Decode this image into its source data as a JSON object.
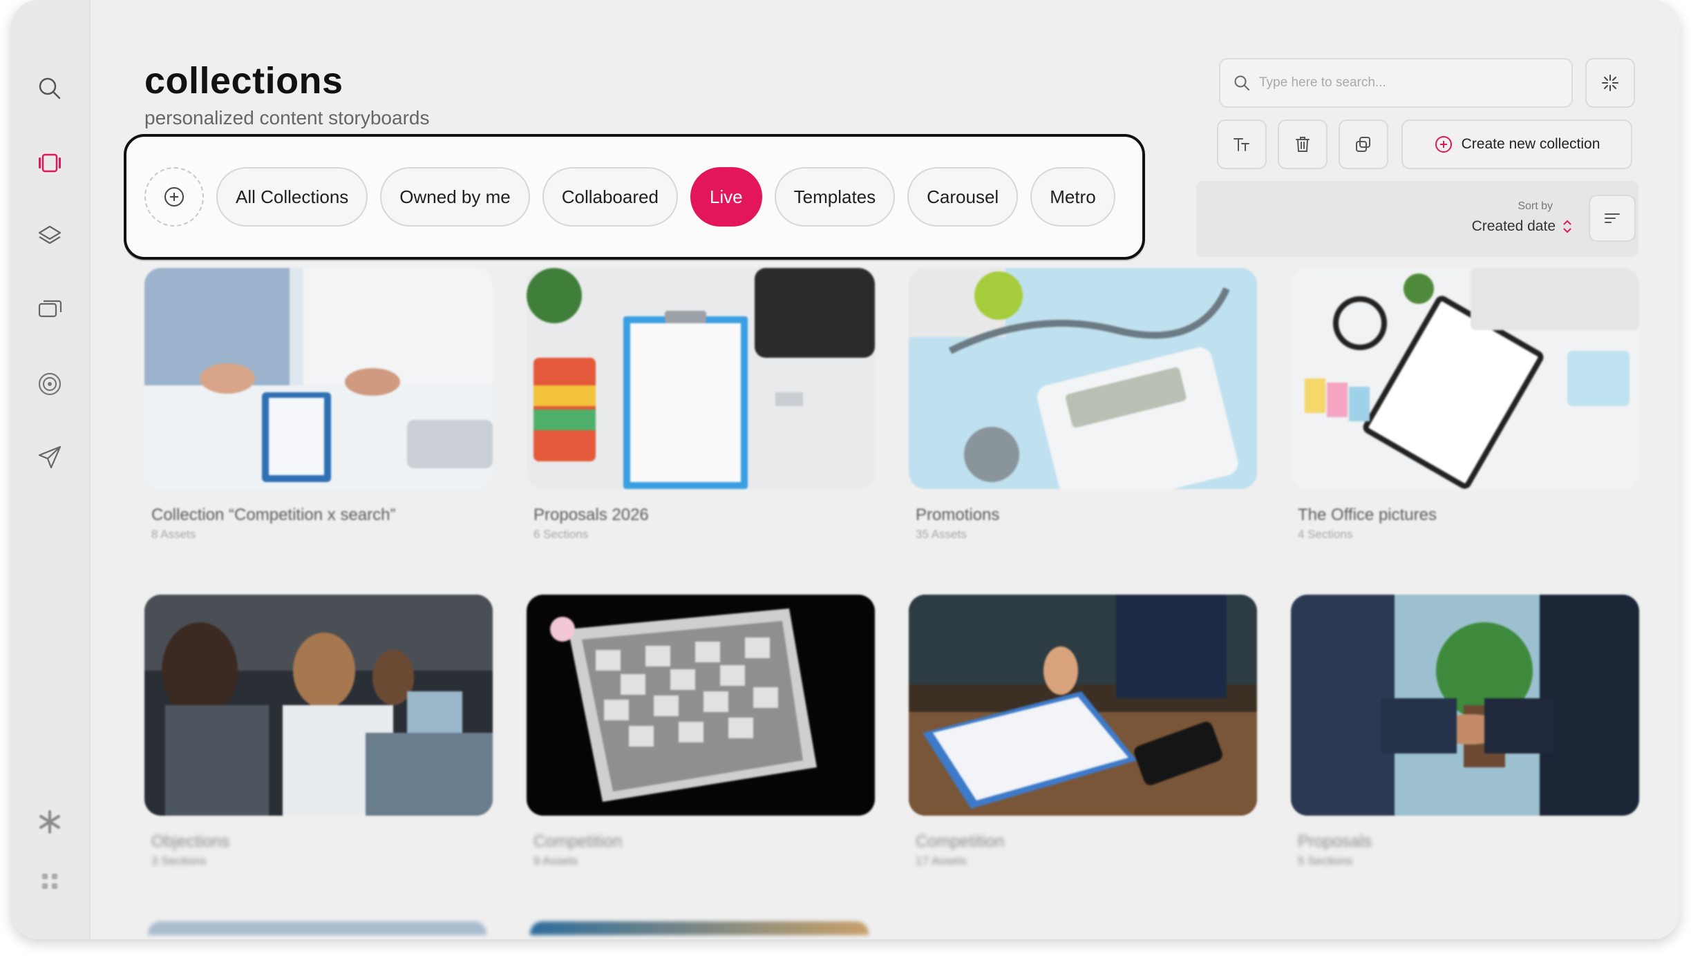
{
  "header": {
    "title": "collections",
    "subtitle": "personalized content storyboards"
  },
  "search": {
    "placeholder": "Type here to search..."
  },
  "toolbar": {
    "create_label": "Create new collection"
  },
  "sort": {
    "label": "Sort by",
    "value": "Created date"
  },
  "filters": {
    "chips": [
      "All Collections",
      "Owned by me",
      "Collaboared",
      "Live",
      "Templates",
      "Carousel",
      "Metro"
    ],
    "active": "Live"
  },
  "colors": {
    "accent": "#e3155b",
    "background": "#efefef",
    "sidebar": "#e9e9e9"
  },
  "sidebar": {
    "icons": [
      "search-icon",
      "collections-icon",
      "layers-icon",
      "chat-icon",
      "target-icon",
      "send-icon",
      "asterisk-icon",
      "grid-icon"
    ],
    "active": "collections-icon"
  },
  "cards": [
    {
      "title": "Collection “Competition x search”",
      "meta": "8 Assets"
    },
    {
      "title": "Proposals 2026",
      "meta": "6 Sections"
    },
    {
      "title": "Promotions",
      "meta": "35 Assets"
    },
    {
      "title": "The Office pictures",
      "meta": "4 Sections"
    },
    {
      "title": "Objections",
      "meta": "3 Sections"
    },
    {
      "title": "Competition",
      "meta": "9 Assets"
    },
    {
      "title": "Competition",
      "meta": "17 Assets"
    },
    {
      "title": "Proposals",
      "meta": "5 Sections"
    }
  ]
}
